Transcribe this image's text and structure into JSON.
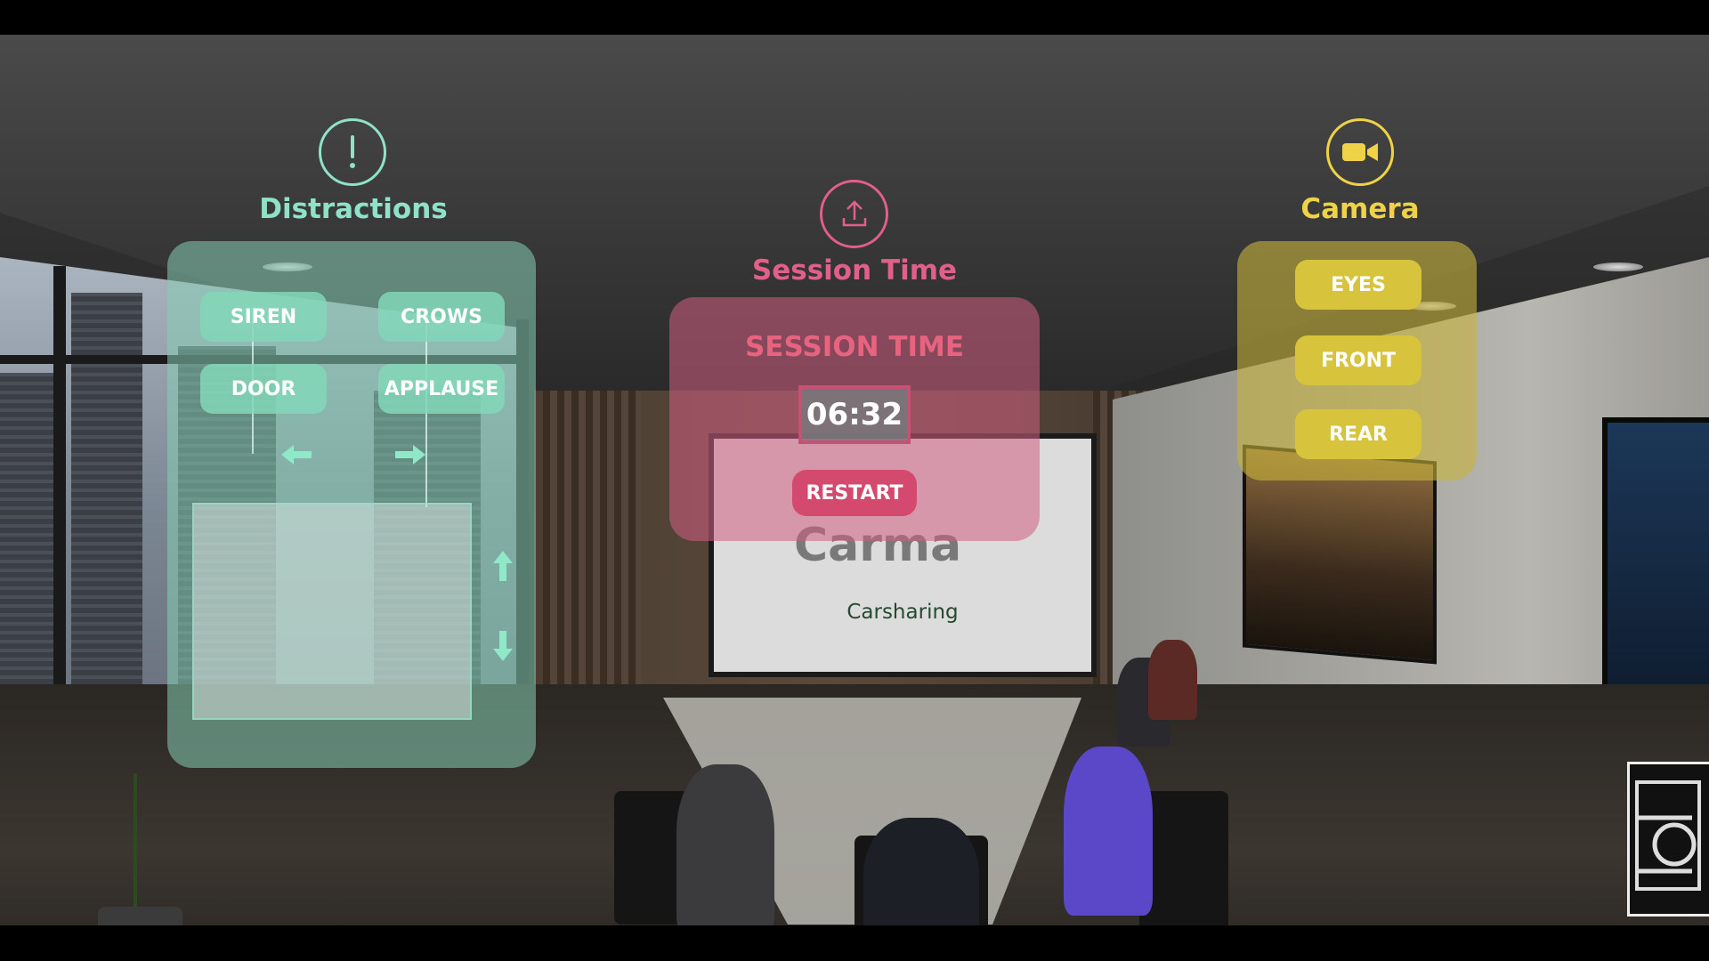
{
  "distractions": {
    "title": "Distractions",
    "icon": "alert-icon",
    "buttons": [
      "SIREN",
      "CROWS",
      "DOOR",
      "APPLAUSE"
    ],
    "color": "#8fe2c8"
  },
  "session": {
    "title": "Session Time",
    "heading": "SESSION TIME",
    "timer": "06:32",
    "restart_label": "RESTART",
    "icon": "upload-icon",
    "color": "#e0608a"
  },
  "camera": {
    "title": "Camera",
    "icon": "video-camera-icon",
    "buttons": [
      "EYES",
      "FRONT",
      "REAR"
    ],
    "color": "#f0d248"
  },
  "scene": {
    "screen_caption": "Carsharing"
  }
}
